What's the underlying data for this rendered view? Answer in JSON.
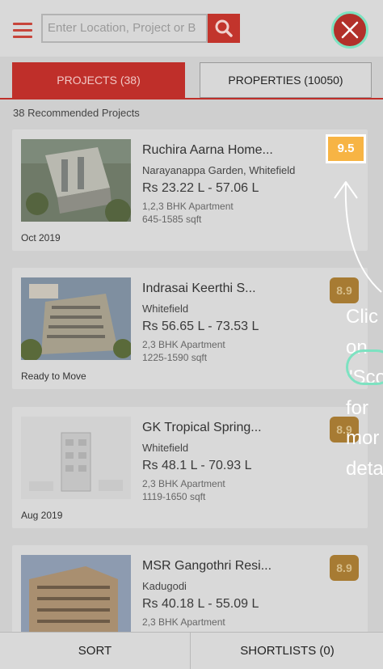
{
  "header": {
    "menu_icon": "hamburger-icon",
    "search_placeholder": "Enter Location, Project or B",
    "search_icon": "search-icon",
    "close_icon": "close-icon"
  },
  "tabs": [
    {
      "label": "PROJECTS (38)",
      "active": true
    },
    {
      "label": "PROPERTIES (10050)",
      "active": false
    }
  ],
  "section_title": "38 Recommended Projects",
  "projects": [
    {
      "name": "Ruchira Aarna Home...",
      "location": "Narayanappa Garden, Whitefield",
      "price": "Rs 23.22 L - 57.06 L",
      "config": "1,2,3 BHK Apartment",
      "area": "645-1585 sqft",
      "status": "Oct 2019",
      "score": "9.5"
    },
    {
      "name": "Indrasai Keerthi S...",
      "location": "Whitefield",
      "price": "Rs 56.65 L - 73.53 L",
      "config": "2,3 BHK Apartment",
      "area": "1225-1590 sqft",
      "status": "Ready to Move",
      "score": "8.9"
    },
    {
      "name": "GK Tropical Spring...",
      "location": "Whitefield",
      "price": "Rs 48.1 L - 70.93 L",
      "config": "2,3 BHK Apartment",
      "area": "1119-1650 sqft",
      "status": "Aug 2019",
      "score": "8.9"
    },
    {
      "name": "MSR Gangothri Resi...",
      "location": "Kadugodi",
      "price": "Rs 40.18 L - 55.09 L",
      "config": "2,3 BHK Apartment",
      "area": "",
      "status": "",
      "score": "8.9"
    }
  ],
  "callout": {
    "lines": [
      "Clic",
      "on",
      "\"Sco",
      "for",
      "mor",
      "deta"
    ]
  },
  "bottom_bar": {
    "sort_label": "SORT",
    "shortlists_label": "SHORTLISTS (0)"
  },
  "colors": {
    "brand_red": "#c2342c",
    "score_orange": "#f7b444",
    "highlight_teal": "#7de2c1"
  }
}
